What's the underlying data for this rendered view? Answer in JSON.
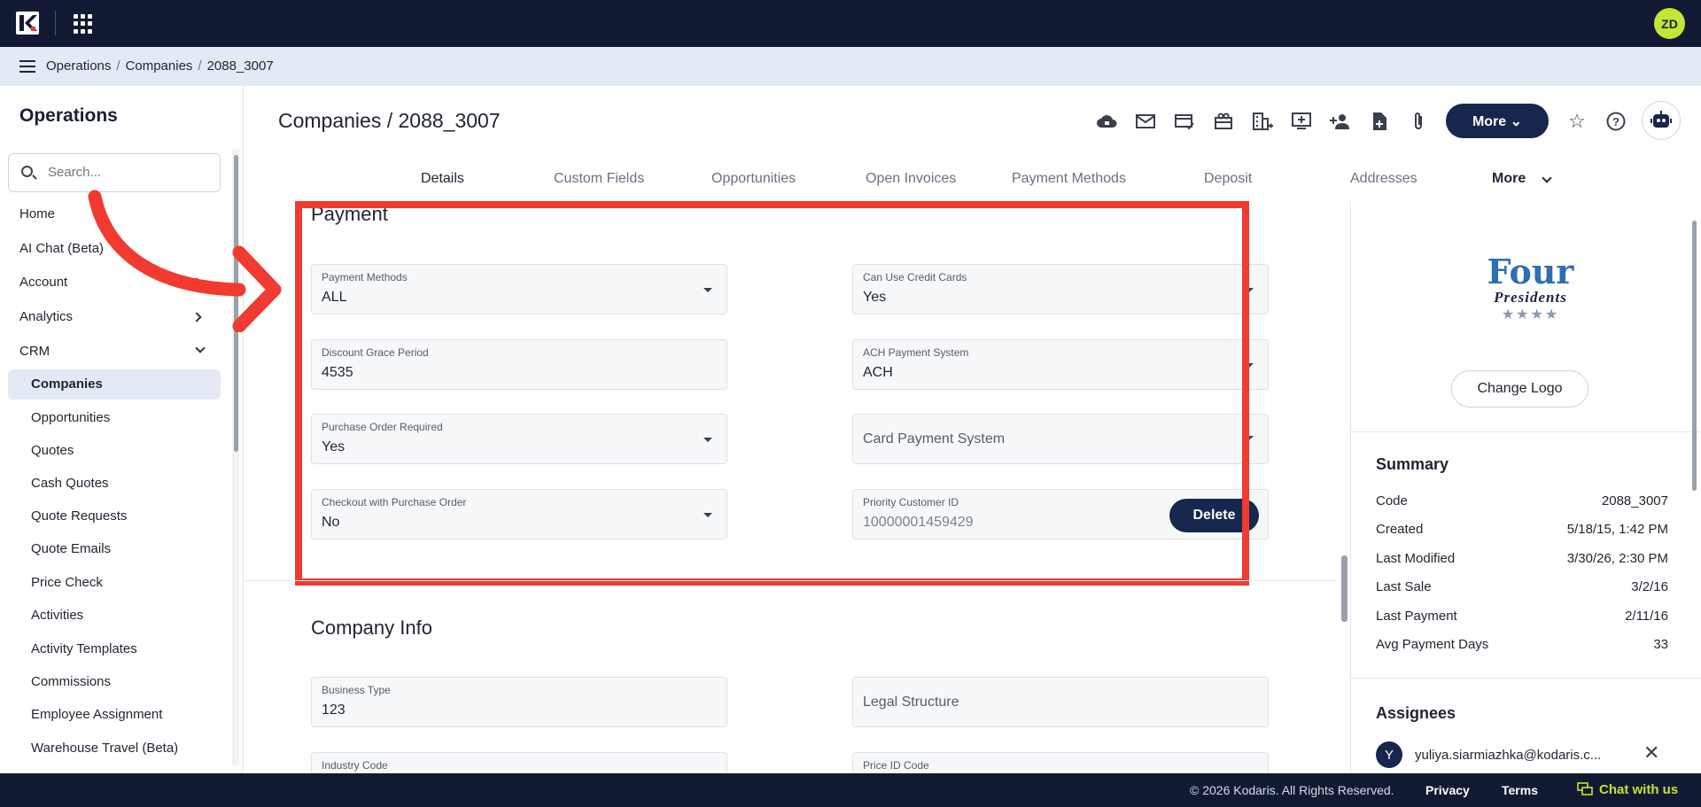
{
  "topbar": {
    "avatar_initials": "ZD"
  },
  "breadcrumb": [
    "Operations",
    "Companies",
    "2088_3007"
  ],
  "sidebar": {
    "title": "Operations",
    "search_placeholder": "Search...",
    "items": [
      {
        "label": "Home"
      },
      {
        "label": "AI Chat (Beta)"
      },
      {
        "label": "Account"
      },
      {
        "label": "Analytics"
      },
      {
        "label": "CRM"
      }
    ],
    "sub_items": [
      {
        "label": "Companies"
      },
      {
        "label": "Opportunities"
      },
      {
        "label": "Quotes"
      },
      {
        "label": "Cash Quotes"
      },
      {
        "label": "Quote Requests"
      },
      {
        "label": "Quote Emails"
      },
      {
        "label": "Price Check"
      },
      {
        "label": "Activities"
      },
      {
        "label": "Activity Templates"
      },
      {
        "label": "Commissions"
      },
      {
        "label": "Employee Assignment"
      },
      {
        "label": "Warehouse Travel (Beta)"
      }
    ]
  },
  "header": {
    "title": "Companies / 2088_3007",
    "more_label": "More",
    "tabs": [
      "Details",
      "Custom Fields",
      "Opportunities",
      "Open Invoices",
      "Payment Methods",
      "Deposit",
      "Addresses",
      "More"
    ]
  },
  "payment": {
    "title": "Payment",
    "fields": {
      "payment_methods": {
        "label": "Payment Methods",
        "value": "ALL"
      },
      "can_use_credit_cards": {
        "label": "Can Use Credit Cards",
        "value": "Yes"
      },
      "discount_grace_period": {
        "label": "Discount Grace Period",
        "value": "4535"
      },
      "ach_payment_system": {
        "label": "ACH Payment System",
        "value": "ACH"
      },
      "purchase_order_required": {
        "label": "Purchase Order Required",
        "value": "Yes"
      },
      "card_payment_system": {
        "placeholder": "Card Payment System"
      },
      "checkout_with_po": {
        "label": "Checkout with Purchase Order",
        "value": "No"
      },
      "priority_customer_id": {
        "label": "Priority Customer ID",
        "value": "10000001459429"
      }
    },
    "delete_label": "Delete"
  },
  "company_info": {
    "title": "Company Info",
    "fields": {
      "business_type": {
        "label": "Business Type",
        "value": "123"
      },
      "legal_structure": {
        "placeholder": "Legal Structure"
      },
      "industry_code": {
        "label": "Industry Code"
      },
      "price_id_code": {
        "label": "Price ID Code"
      }
    }
  },
  "right_panel": {
    "brand": {
      "line1": "Four",
      "line2": "Presidents",
      "stars": "★★★★"
    },
    "change_logo_label": "Change Logo",
    "summary_title": "Summary",
    "summary": [
      {
        "label": "Code",
        "value": "2088_3007"
      },
      {
        "label": "Created",
        "value": "5/18/15, 1:42 PM"
      },
      {
        "label": "Last Modified",
        "value": "3/30/26, 2:30 PM"
      },
      {
        "label": "Last Sale",
        "value": "3/2/16"
      },
      {
        "label": "Last Payment",
        "value": "2/11/16"
      },
      {
        "label": "Avg Payment Days",
        "value": "33"
      }
    ],
    "assignees_title": "Assignees",
    "assignee": {
      "initial": "Y",
      "email": "yuliya.siarmiazhka@kodaris.c..."
    }
  },
  "footer": {
    "copyright": "© 2026 Kodaris. All Rights Reserved.",
    "privacy": "Privacy",
    "terms": "Terms",
    "chat": "Chat with us"
  },
  "colors": {
    "navy": "#121a33",
    "button_navy": "#16264d",
    "accent_lime": "#c3e534",
    "annotation_red": "#f13a30"
  }
}
